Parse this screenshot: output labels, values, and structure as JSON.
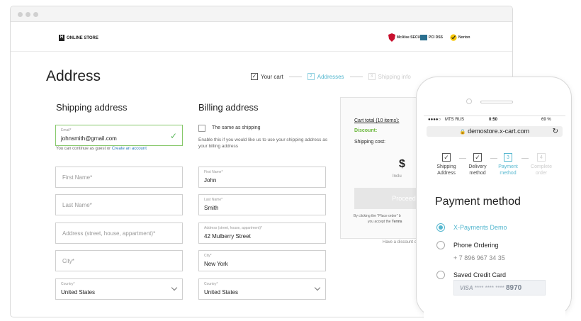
{
  "header": {
    "logo_text": "ONLINE STORE",
    "badges": [
      "McAfee SECURE",
      "PCI DSS",
      "Norton"
    ]
  },
  "page": {
    "title": "Address"
  },
  "steps": [
    {
      "label": "Your cart",
      "state": "done"
    },
    {
      "label": "Addresses",
      "state": "active",
      "num": "2"
    },
    {
      "label": "Shipping info",
      "state": "pending",
      "num": "3"
    }
  ],
  "shipping": {
    "heading": "Shipping address",
    "email": {
      "label": "Email*",
      "value": "johnsmith@gmail.com"
    },
    "email_note": "You can continue as guest or",
    "create_account": "Create an account",
    "first_name_ph": "First Name*",
    "last_name_ph": "Last Name*",
    "address_ph": "Address (street, house, appartment)*",
    "city_ph": "City*",
    "country": {
      "label": "Country*",
      "value": "United States"
    }
  },
  "billing": {
    "heading": "Billing address",
    "same_as_shipping": "The same as shipping",
    "note": "Enable this if you would like us to use your shipping address as your billing address",
    "first_name": {
      "label": "First Name*",
      "value": "John"
    },
    "last_name": {
      "label": "Last Name*",
      "value": "Smith"
    },
    "address": {
      "label": "Address (street, house, appartment)*",
      "value": "42 Mulberry Street"
    },
    "city": {
      "label": "City*",
      "value": "New York"
    },
    "country": {
      "label": "Country*",
      "value": "United States"
    }
  },
  "summary": {
    "cart_total": "Cart total (10 items):",
    "discount": "Discount:",
    "shipping_cost": "Shipping cost:",
    "total_symbol": "$",
    "included": "Inclu",
    "place_order": "Proceed to",
    "fine_print_1": "By clicking the \"Place order\" b",
    "fine_print_2": "you accept the",
    "terms": "Terms",
    "discount_link": "Have a discount c"
  },
  "phone": {
    "carrier": "MTS RUS",
    "time": "0:50",
    "battery": "69 %",
    "url": "demostore.x-cart.com",
    "steps": [
      {
        "label": "Shipping Address",
        "state": "done"
      },
      {
        "label": "Delivery method",
        "state": "done"
      },
      {
        "label": "Payment method",
        "state": "active",
        "num": "3"
      },
      {
        "label": "Complete order",
        "state": "pending",
        "num": "4"
      }
    ],
    "title": "Payment method",
    "options": [
      {
        "label": "X-Payments Demo",
        "selected": true
      },
      {
        "label": "Phone Ordering",
        "selected": false
      },
      {
        "label": "Saved Credit Card",
        "selected": false
      }
    ],
    "phone_number": "+ 7 896 967 34 35",
    "card_brand": "VISA",
    "card_mask": "**** **** ****",
    "card_last": "8970"
  },
  "colors": {
    "accent": "#55b7cf",
    "success": "#5cb85c"
  }
}
